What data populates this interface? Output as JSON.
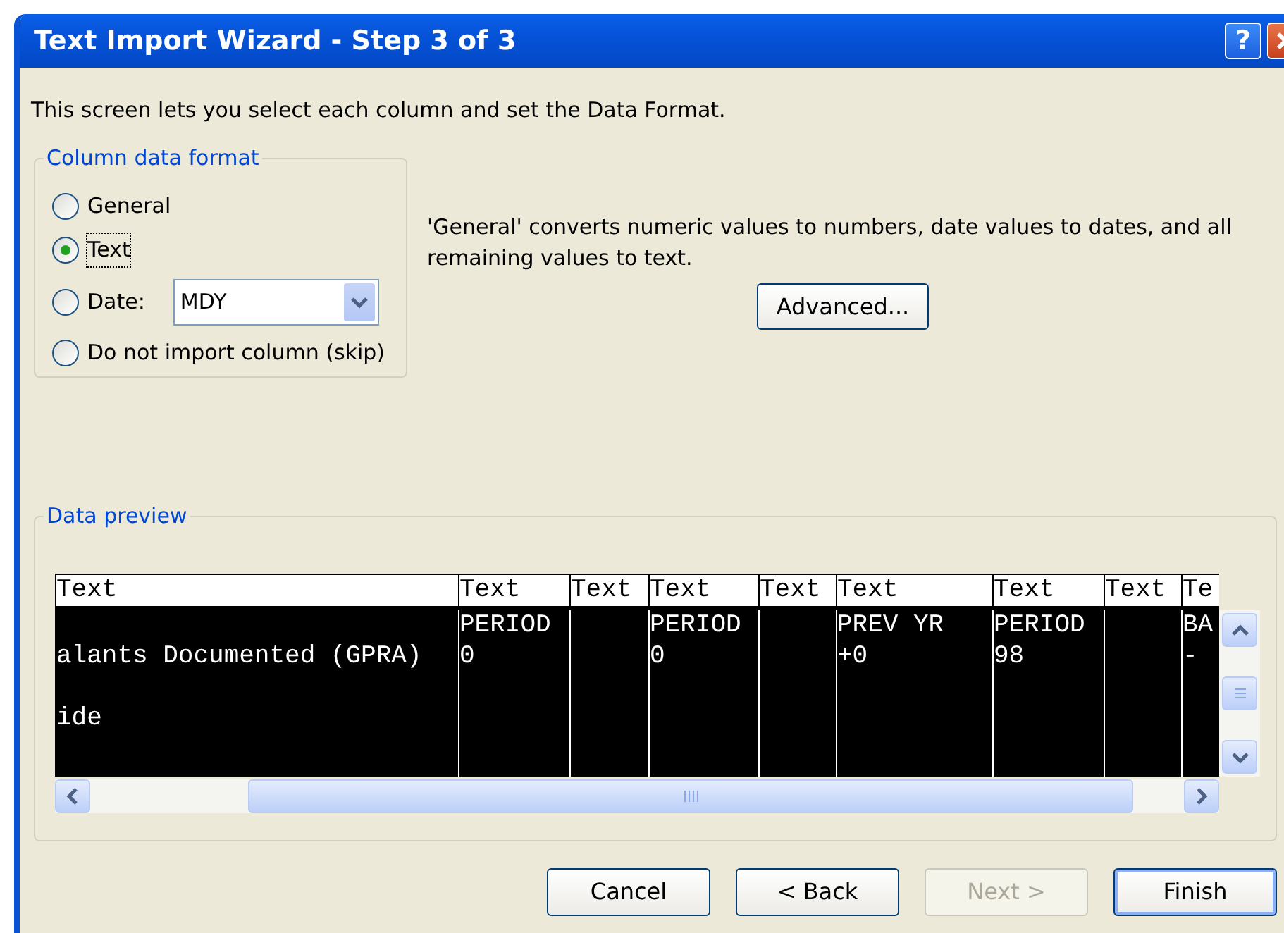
{
  "window": {
    "title": "Text Import Wizard - Step 3 of 3",
    "help_button": "?"
  },
  "intro": "This screen lets you select each column and set the Data Format.",
  "column_data_format": {
    "legend": "Column data format",
    "options": [
      {
        "kind": "plain",
        "label": "General",
        "selected": false,
        "focused": false
      },
      {
        "kind": "plain",
        "label": "Text",
        "selected": true,
        "focused": true
      },
      {
        "kind": "date",
        "label": "Date:",
        "selected": false,
        "focused": false,
        "dropdown_value": "MDY"
      },
      {
        "kind": "plain",
        "label": "Do not import column (skip)",
        "selected": false,
        "focused": false
      }
    ]
  },
  "description": "'General' converts numeric values to numbers, date values to dates, and all remaining values to text.",
  "advanced_button": "Advanced...",
  "data_preview": {
    "legend": "Data preview",
    "columns": [
      {
        "header": "Text",
        "selected": true
      },
      {
        "header": "Text",
        "selected": true
      },
      {
        "header": "Text",
        "selected": true
      },
      {
        "header": "Text",
        "selected": true
      },
      {
        "header": "Text",
        "selected": true
      },
      {
        "header": "Text",
        "selected": true
      },
      {
        "header": "Text",
        "selected": true
      },
      {
        "header": "Text",
        "selected": true
      },
      {
        "header": "Te",
        "selected": true
      }
    ],
    "rows": [
      [
        null,
        "PERIOD",
        null,
        "PERIOD",
        null,
        "PREV YR",
        "PERIOD",
        null,
        "BA"
      ],
      [
        "alants Documented (GPRA)",
        "0",
        null,
        "0",
        null,
        "+0",
        "98",
        null,
        "-"
      ],
      [
        null,
        null,
        null,
        null,
        null,
        null,
        null,
        null,
        null
      ],
      [
        "ide",
        null,
        null,
        null,
        null,
        null,
        null,
        null,
        null
      ]
    ]
  },
  "buttons": [
    {
      "label": "Cancel",
      "disabled": false,
      "default": false
    },
    {
      "label": "< Back",
      "disabled": false,
      "default": false
    },
    {
      "label": "Next >",
      "disabled": true,
      "default": false
    },
    {
      "label": "Finish",
      "disabled": false,
      "default": true
    }
  ]
}
